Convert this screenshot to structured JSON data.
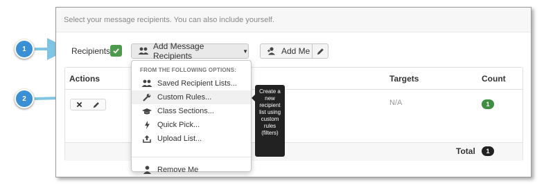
{
  "instruction": "Select your message recipients. You can also include yourself.",
  "recipients": {
    "label": "Recipients"
  },
  "buttons": {
    "add_message_recipients": "Add Message Recipients",
    "add_me": "Add Me"
  },
  "table": {
    "headers": {
      "actions": "Actions",
      "targets": "Targets",
      "count": "Count"
    },
    "row": {
      "targets": "N/A",
      "count": "1"
    },
    "total": {
      "label": "Total",
      "count": "1"
    }
  },
  "dropdown": {
    "heading": "FROM THE FOLLOWING OPTIONS:",
    "items": [
      {
        "label": "Saved Recipient Lists...",
        "icon": "users-icon"
      },
      {
        "label": "Custom Rules...",
        "icon": "wrench-icon"
      },
      {
        "label": "Class Sections...",
        "icon": "graduation-cap-icon"
      },
      {
        "label": "Quick Pick...",
        "icon": "bolt-icon"
      },
      {
        "label": "Upload List...",
        "icon": "upload-icon"
      }
    ],
    "remove_me": {
      "label": "Remove Me",
      "icon": "user-icon"
    }
  },
  "tooltip": {
    "text": "Create a new recipient list using custom rules (filters)"
  },
  "callouts": [
    "1",
    "2"
  ],
  "colors": {
    "callout": "#3b8fd4",
    "check": "#4d9a4d",
    "count_badge": "#3f8e42",
    "tooltip": "#222222"
  }
}
